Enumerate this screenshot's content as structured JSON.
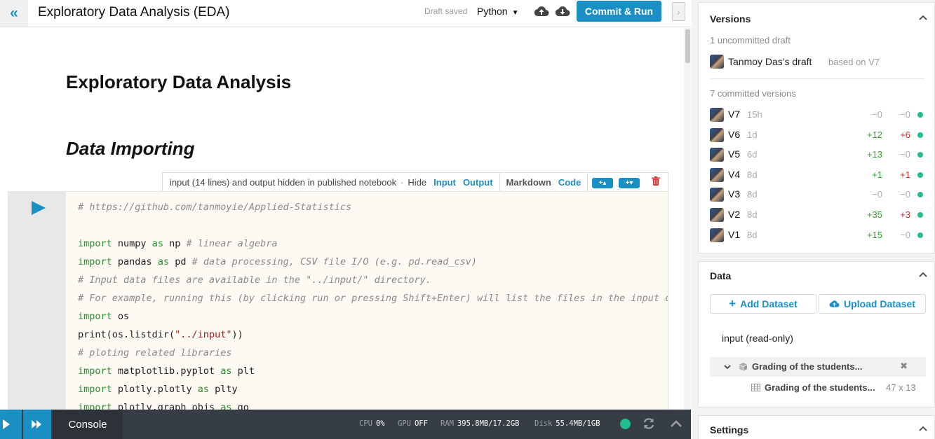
{
  "topbar": {
    "title": "Exploratory Data Analysis (EDA)",
    "draft_status": "Draft saved",
    "language": "Python",
    "commit_label": "Commit & Run"
  },
  "notebook": {
    "heading": "Exploratory Data Analysis",
    "subheading": "Data Importing",
    "cell_toolbar": {
      "note": "input (14 lines) and output hidden in published notebook",
      "dot": "·",
      "hide": "Hide",
      "input": "Input",
      "output": "Output",
      "markdown": "Markdown",
      "code": "Code"
    },
    "code_lines": [
      "# https://github.com/tanmoyie/Applied-Statistics",
      "",
      "import numpy as np # linear algebra",
      "import pandas as pd # data processing, CSV file I/O (e.g. pd.read_csv)",
      "# Input data files are available in the \"../input/\" directory.",
      "# For example, running this (by clicking run or pressing Shift+Enter) will list the files in the input directory",
      "import os",
      "print(os.listdir(\"../input\"))",
      "# ploting related libraries",
      "import matplotlib.pyplot as plt",
      "import plotly.plotly as plty",
      "import plotly.graph_objs as go"
    ]
  },
  "statusbar": {
    "console_label": "Console",
    "metrics": [
      {
        "key": "CPU",
        "value": "0%"
      },
      {
        "key": "GPU",
        "value": "OFF"
      },
      {
        "key": "RAM",
        "value": "395.8MB/17.2GB"
      },
      {
        "key": "Disk",
        "value": "55.4MB/1GB"
      }
    ],
    "status_color": "#20be8c"
  },
  "versions": {
    "title": "Versions",
    "uncommitted_label": "1 uncommitted draft",
    "draft_owner": "Tanmoy Das's draft",
    "draft_based_on": "based on V7",
    "committed_label": "7 committed versions",
    "items": [
      {
        "name": "V7",
        "age": "15h",
        "added": "−0",
        "removed": "−0"
      },
      {
        "name": "V6",
        "age": "1d",
        "added": "+12",
        "removed": "+6"
      },
      {
        "name": "V5",
        "age": "6d",
        "added": "+13",
        "removed": "−0"
      },
      {
        "name": "V4",
        "age": "8d",
        "added": "+1",
        "removed": "+1"
      },
      {
        "name": "V3",
        "age": "8d",
        "added": "−0",
        "removed": "−0"
      },
      {
        "name": "V2",
        "age": "8d",
        "added": "+35",
        "removed": "+3"
      },
      {
        "name": "V1",
        "age": "8d",
        "added": "+15",
        "removed": "−0"
      }
    ]
  },
  "data_panel": {
    "title": "Data",
    "add_dataset": "Add Dataset",
    "upload_dataset": "Upload Dataset",
    "input_label": "input (read-only)",
    "dataset_name": "Grading of the students...",
    "table_name": "Grading of the students...",
    "table_dims": "47 x 13"
  },
  "settings": {
    "title": "Settings"
  },
  "colors": {
    "accent": "#1a8fc3",
    "positive": "#2e9e2e",
    "negative": "#c33030",
    "status_ok": "#20be8c"
  }
}
